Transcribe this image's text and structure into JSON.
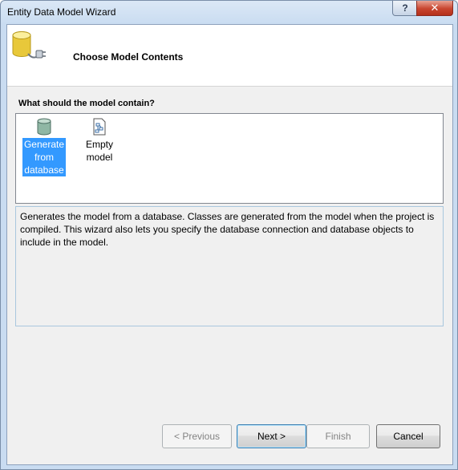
{
  "window": {
    "title": "Entity Data Model Wizard",
    "help_label": "?",
    "close_label": "✕"
  },
  "header": {
    "title": "Choose Model Contents",
    "icon": "database-connector-icon"
  },
  "prompt": "What should the model contain?",
  "options": [
    {
      "label": "Generate from database",
      "icon": "database-icon",
      "selected": true
    },
    {
      "label": "Empty model",
      "icon": "empty-model-icon",
      "selected": false
    }
  ],
  "description": "Generates the model from a database. Classes are generated from the model when the project is compiled. This wizard also lets you specify the database connection and database objects to include in the model.",
  "buttons": {
    "previous": "< Previous",
    "next": "Next >",
    "finish": "Finish",
    "cancel": "Cancel"
  },
  "colors": {
    "selection": "#3399ff",
    "title_bar": "#c9dcf1",
    "close_button": "#c8452f"
  }
}
